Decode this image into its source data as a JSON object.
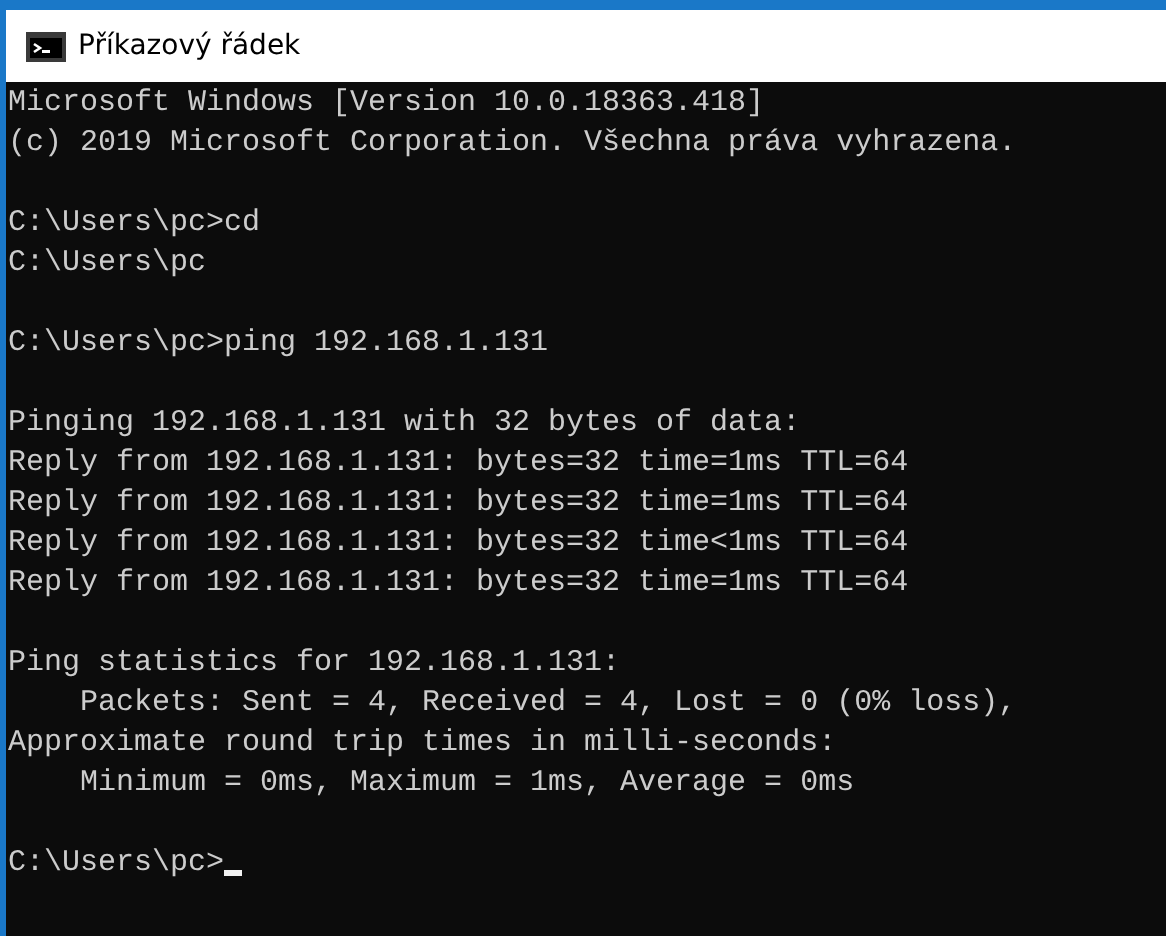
{
  "window": {
    "title": "Příkazový řádek"
  },
  "console": {
    "blocks": [
      [
        "Microsoft Windows [Version 10.0.18363.418]",
        "(c) 2019 Microsoft Corporation. Všechna práva vyhrazena."
      ],
      [
        "C:\\Users\\pc>cd",
        "C:\\Users\\pc"
      ],
      [
        "C:\\Users\\pc>ping 192.168.1.131"
      ],
      [
        "Pinging 192.168.1.131 with 32 bytes of data:",
        "Reply from 192.168.1.131: bytes=32 time=1ms TTL=64",
        "Reply from 192.168.1.131: bytes=32 time=1ms TTL=64",
        "Reply from 192.168.1.131: bytes=32 time<1ms TTL=64",
        "Reply from 192.168.1.131: bytes=32 time=1ms TTL=64"
      ],
      [
        "Ping statistics for 192.168.1.131:",
        "    Packets: Sent = 4, Received = 4, Lost = 0 (0% loss),",
        "Approximate round trip times in milli-seconds:",
        "    Minimum = 0ms, Maximum = 1ms, Average = 0ms"
      ]
    ],
    "prompt": {
      "text": "C:\\Users\\pc>",
      "cursor": true
    }
  }
}
